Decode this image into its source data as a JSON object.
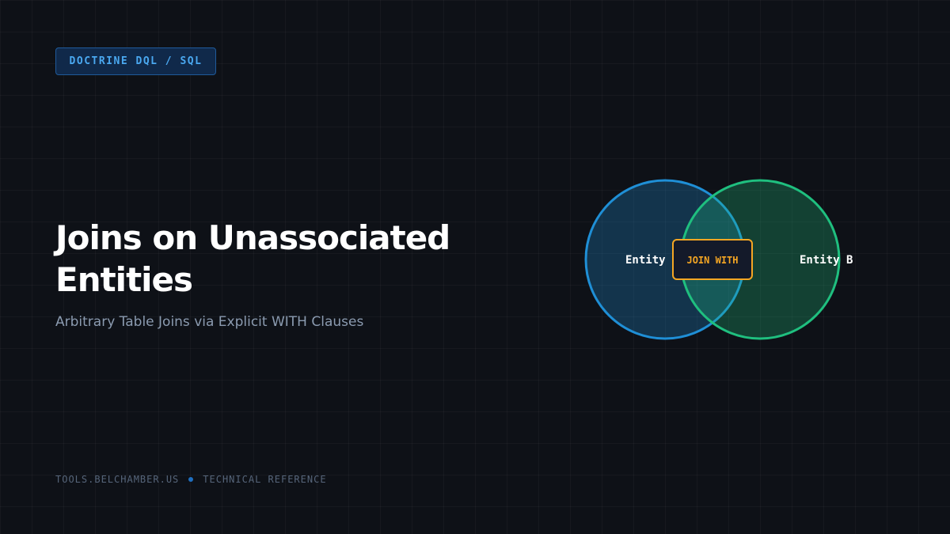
{
  "badge": "DOCTRINE DQL / SQL",
  "title": "Joins on Unassociated Entities",
  "subtitle": "Arbitrary Table Joins via Explicit WITH Clauses",
  "footer": {
    "site": "TOOLS.BELCHAMBER.US",
    "section": "TECHNICAL REFERENCE"
  },
  "diagram": {
    "left_label": "Entity",
    "right_label": "Entity B",
    "center_label": "JOIN WITH"
  },
  "colors": {
    "background": "#0e1117",
    "accent_blue": "#1f8fd6",
    "accent_green": "#1fbf7f",
    "accent_orange": "#f5a623"
  }
}
